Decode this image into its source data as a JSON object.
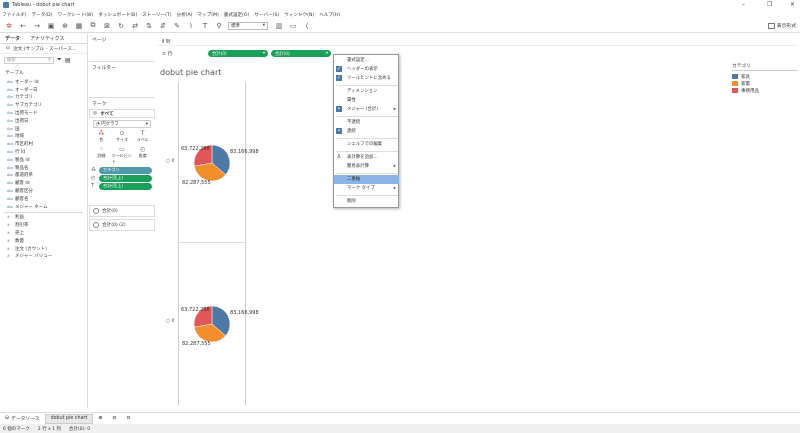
{
  "window": {
    "title": "Tableau - dobut pie chart"
  },
  "menu": [
    "ファイル(F)",
    "データ(D)",
    "ワークシート(W)",
    "ダッシュボード(B)",
    "ストーリー(T)",
    "分析(A)",
    "マップ(M)",
    "書式設定(O)",
    "サーバー(S)",
    "ウィンドウ(N)",
    "ヘルプ(H)"
  ],
  "toolbar": {
    "fit": "標準",
    "show_me": "表示形式"
  },
  "datapane": {
    "tabs": [
      "データ",
      "アナリティクス"
    ],
    "datasource": "注文 (サンプル - スーパース...",
    "search_placeholder": "検索",
    "tables_header": "テーブル",
    "dimensions": [
      "オーダー Id",
      "オーダー日",
      "カテゴリ",
      "サブカテゴリ",
      "出荷モード",
      "出荷日",
      "国",
      "地域",
      "市区町村",
      "行 Id",
      "製品 Id",
      "製品名",
      "都道府県",
      "顧客 Id",
      "顧客区分",
      "顧客名",
      "メジャー ネーム"
    ],
    "measures": [
      "利益",
      "割引率",
      "売上",
      "数量",
      "注文 (カウント)",
      "メジャー バリュー"
    ]
  },
  "cards": {
    "pages": "ページ",
    "filters": "フィルター",
    "marks": "マーク",
    "all": "すべて",
    "mark_type": "円グラフ",
    "buttons": [
      "色",
      "サイズ",
      "ラベル",
      "詳細",
      "ツールヒント",
      "角度"
    ],
    "pills": [
      "カテゴリ",
      "合計(売上)",
      "合計(売上)"
    ],
    "sum0": "合計(0)",
    "sum0_2": "合計(0) (2)"
  },
  "shelves": {
    "columns_label": "列",
    "rows_label": "行",
    "row_pills": [
      "合計(0)",
      "合計(0)"
    ]
  },
  "viz": {
    "title": "dobut pie chart",
    "axis_zero": "0",
    "labels": [
      "63,722,288",
      "83,166,998",
      "82,287,555"
    ]
  },
  "legend": {
    "title": "カテゴリ",
    "items": [
      {
        "name": "家具",
        "color": "#4e79a7"
      },
      {
        "name": "家電",
        "color": "#f28e2b"
      },
      {
        "name": "事務用品",
        "color": "#e15759"
      }
    ]
  },
  "chart_data": {
    "type": "pie",
    "categories": [
      "家具",
      "家電",
      "事務用品"
    ],
    "values": [
      83166998,
      82287555,
      63722288
    ],
    "colors": [
      "#4e79a7",
      "#f28e2b",
      "#e15759"
    ],
    "title": "dobut pie chart"
  },
  "context_menu": {
    "items": [
      "書式設定...",
      "ヘッダーの表示",
      "ツールヒントに含める",
      "ディメンション",
      "属性",
      "メジャー (合計)",
      "不連続",
      "連続",
      "シェルフでの編集",
      "表計算を追加...",
      "簡易表計算",
      "二重軸",
      "マーク タイプ",
      "削除"
    ]
  },
  "tabs": {
    "datasource": "データソース",
    "sheet": "dobut pie chart"
  },
  "status": {
    "marks": "6 個のマーク",
    "rows": "2 行 x 1 列",
    "sum": "合計(0): 0"
  }
}
